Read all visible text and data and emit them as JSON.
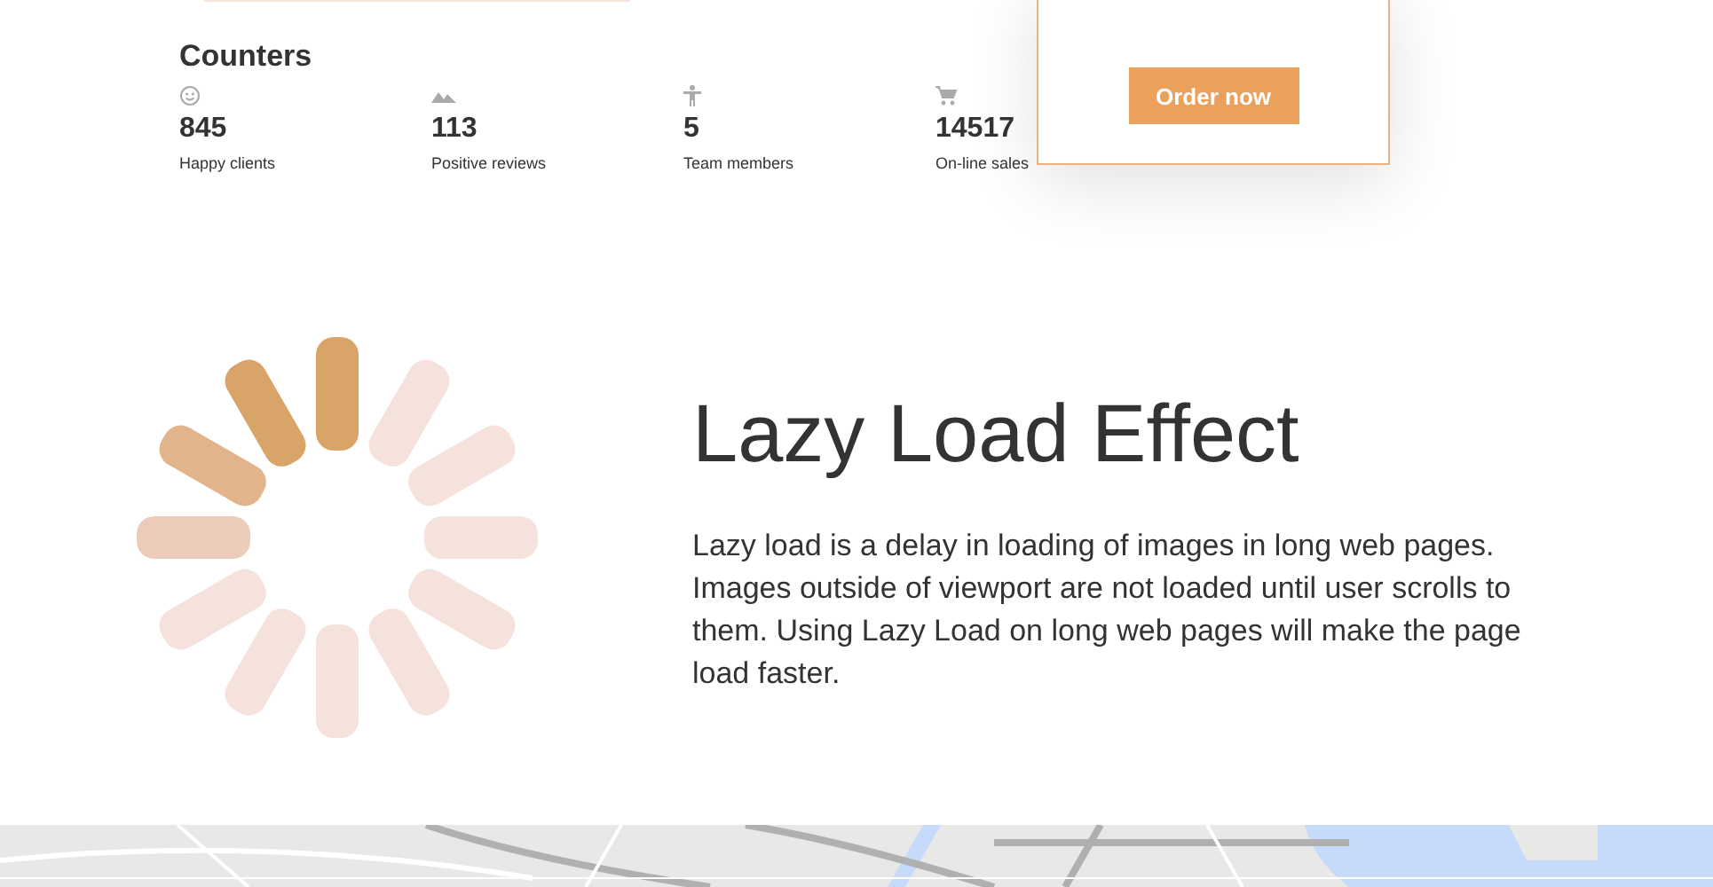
{
  "counters": {
    "title": "Counters",
    "items": [
      {
        "kind": "smile",
        "value": "845",
        "label": "Happy clients"
      },
      {
        "kind": "mountain",
        "value": "113",
        "label": "Positive reviews"
      },
      {
        "kind": "person",
        "value": "5",
        "label": "Team members"
      },
      {
        "kind": "cart",
        "value": "14517",
        "label": "On-line sales"
      }
    ]
  },
  "pricing_card": {
    "button": "Order now"
  },
  "lazy_load": {
    "title": "Lazy Load Effect",
    "text": "Lazy load is a delay in loading of images in long web pages. Images outside of viewport are not loaded until user scrolls to them. Using Lazy Load on long web pages will make the page load faster."
  }
}
